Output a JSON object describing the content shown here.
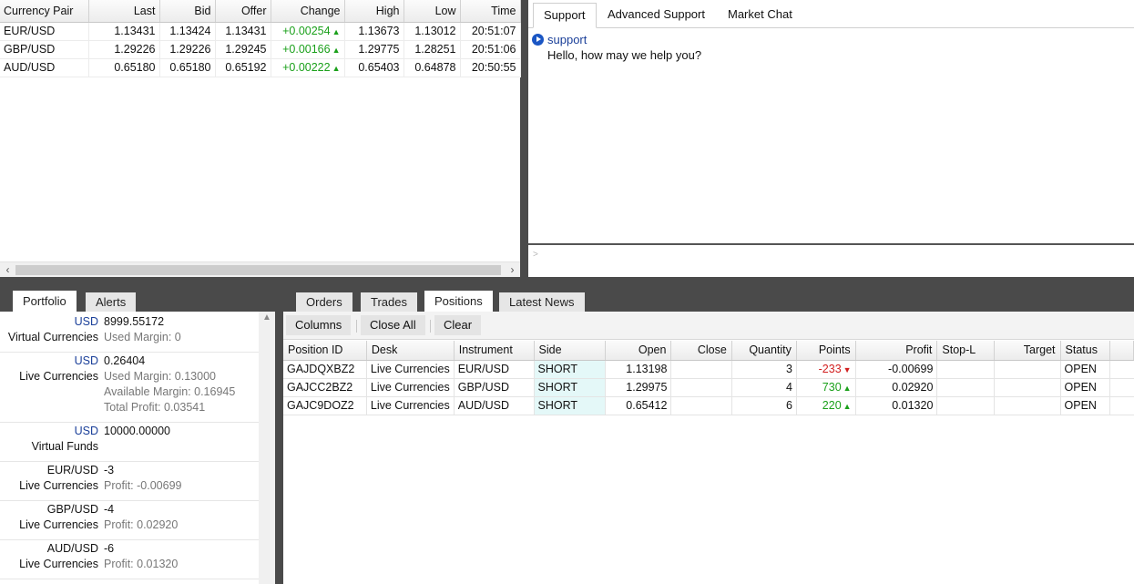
{
  "quotes": {
    "columns": [
      "Currency Pair",
      "Last",
      "Bid",
      "Offer",
      "Change",
      "High",
      "Low",
      "Time"
    ],
    "rows": [
      {
        "pair": "EUR/USD",
        "last": "1.13431",
        "bid": "1.13424",
        "offer": "1.13431",
        "change": "+0.00254",
        "dir": "up",
        "high": "1.13673",
        "low": "1.13012",
        "time": "20:51:07"
      },
      {
        "pair": "GBP/USD",
        "last": "1.29226",
        "bid": "1.29226",
        "offer": "1.29245",
        "change": "+0.00166",
        "dir": "up",
        "high": "1.29775",
        "low": "1.28251",
        "time": "20:51:06"
      },
      {
        "pair": "AUD/USD",
        "last": "0.65180",
        "bid": "0.65180",
        "offer": "0.65192",
        "change": "+0.00222",
        "dir": "up",
        "high": "0.65403",
        "low": "0.64878",
        "time": "20:50:55"
      }
    ]
  },
  "support": {
    "tabs": [
      "Support",
      "Advanced Support",
      "Market Chat"
    ],
    "active_tab": "Support",
    "message": {
      "author": "support",
      "text": "Hello, how may we help you?"
    },
    "input_prompt": ">"
  },
  "portfolio": {
    "tabs": [
      "Portfolio",
      "Alerts"
    ],
    "active_tab": "Portfolio",
    "items": [
      {
        "key": "USD",
        "key_style": "usd",
        "value": "8999.55172",
        "category": "Virtual Currencies",
        "subs": [
          "Used Margin:  0"
        ]
      },
      {
        "key": "USD",
        "key_style": "usd",
        "value": "0.26404",
        "category": "Live Currencies",
        "subs": [
          "Used Margin:  0.13000",
          "Available Margin:  0.16945",
          "Total Profit:  0.03541"
        ]
      },
      {
        "key": "USD",
        "key_style": "usd",
        "value": "10000.00000",
        "category": "Virtual Funds",
        "subs": []
      },
      {
        "key": "EUR/USD",
        "key_style": "pair",
        "value": "-3",
        "category": "Live Currencies",
        "subs": [
          "Profit:  -0.00699"
        ]
      },
      {
        "key": "GBP/USD",
        "key_style": "pair",
        "value": "-4",
        "category": "Live Currencies",
        "subs": [
          "Profit:  0.02920"
        ]
      },
      {
        "key": "AUD/USD",
        "key_style": "pair",
        "value": "-6",
        "category": "Live Currencies",
        "subs": [
          "Profit:  0.01320"
        ]
      }
    ]
  },
  "trading": {
    "tabs": [
      "Orders",
      "Trades",
      "Positions",
      "Latest News"
    ],
    "active_tab": "Positions",
    "toolbar": {
      "columns": "Columns",
      "close_all": "Close All",
      "clear": "Clear"
    },
    "columns": [
      "Position ID",
      "Desk",
      "Instrument",
      "Side",
      "Open",
      "Close",
      "Quantity",
      "Points",
      "Profit",
      "Stop-L",
      "Target",
      "Status"
    ],
    "rows": [
      {
        "id": "GAJDQXBZ2",
        "desk": "Live Currencies",
        "instrument": "EUR/USD",
        "side": "SHORT",
        "open": "1.13198",
        "close": "",
        "quantity": "3",
        "points": "-233",
        "points_dir": "down",
        "profit": "-0.00699",
        "stop": "",
        "target": "",
        "status": "OPEN"
      },
      {
        "id": "GAJCC2BZ2",
        "desk": "Live Currencies",
        "instrument": "GBP/USD",
        "side": "SHORT",
        "open": "1.29975",
        "close": "",
        "quantity": "4",
        "points": "730",
        "points_dir": "up",
        "profit": "0.02920",
        "stop": "",
        "target": "",
        "status": "OPEN"
      },
      {
        "id": "GAJC9DOZ2",
        "desk": "Live Currencies",
        "instrument": "AUD/USD",
        "side": "SHORT",
        "open": "0.65412",
        "close": "",
        "quantity": "6",
        "points": "220",
        "points_dir": "up",
        "profit": "0.01320",
        "stop": "",
        "target": "",
        "status": "OPEN"
      }
    ]
  },
  "colors": {
    "up": "#1aa01a",
    "down": "#d22020",
    "link_blue": "#1a3f99",
    "side_bg": "#e4f8f8"
  },
  "icons": {
    "up": "triangle-up-icon",
    "down": "triangle-down-icon",
    "chat": "play-circle-icon"
  }
}
